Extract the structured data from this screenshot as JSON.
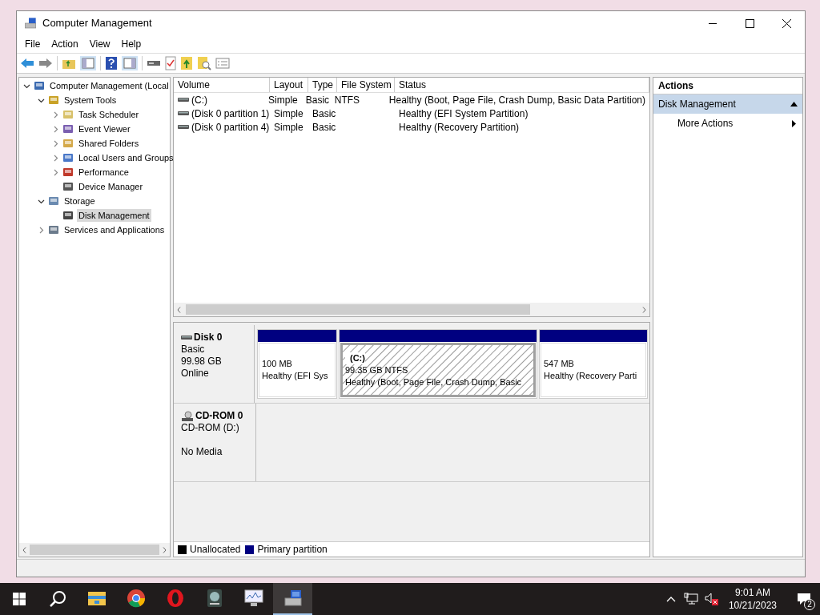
{
  "window": {
    "title": "Computer Management"
  },
  "menu": [
    "File",
    "Action",
    "View",
    "Help"
  ],
  "tree": [
    {
      "label": "Computer Management (Local",
      "expanded": true,
      "selected": false,
      "children": [
        {
          "label": "System Tools",
          "expanded": true,
          "selected": false,
          "children": [
            {
              "label": "Task Scheduler",
              "expanded": false,
              "selected": false
            },
            {
              "label": "Event Viewer",
              "expanded": false,
              "selected": false
            },
            {
              "label": "Shared Folders",
              "expanded": false,
              "selected": false
            },
            {
              "label": "Local Users and Groups",
              "expanded": false,
              "selected": false
            },
            {
              "label": "Performance",
              "expanded": false,
              "selected": false
            },
            {
              "label": "Device Manager",
              "selected": false
            }
          ]
        },
        {
          "label": "Storage",
          "expanded": true,
          "selected": false,
          "children": [
            {
              "label": "Disk Management",
              "selected": true
            }
          ]
        },
        {
          "label": "Services and Applications",
          "expanded": false,
          "selected": false
        }
      ]
    }
  ],
  "volumes": {
    "columns": [
      "Volume",
      "Layout",
      "Type",
      "File System",
      "Status"
    ],
    "rows": [
      {
        "cells": [
          "(C:)",
          "Simple",
          "Basic",
          "NTFS",
          "Healthy (Boot, Page File, Crash Dump, Basic Data Partition)"
        ]
      },
      {
        "cells": [
          "(Disk 0 partition 1)",
          "Simple",
          "Basic",
          "",
          "Healthy (EFI System Partition)"
        ]
      },
      {
        "cells": [
          "(Disk 0 partition 4)",
          "Simple",
          "Basic",
          "",
          "Healthy (Recovery Partition)"
        ]
      }
    ]
  },
  "disks": [
    {
      "kind": "disk",
      "name": "Disk 0",
      "lines": [
        "Basic",
        "99.98 GB",
        "Online"
      ],
      "partitions": [
        {
          "size": "100 MB",
          "status": "Healthy (EFI Sys",
          "selected": false
        },
        {
          "label": "(C:)",
          "size": "99.35 GB NTFS",
          "status": "Healthy (Boot, Page File, Crash Dump, Basic",
          "selected": true
        },
        {
          "size": "547 MB",
          "status": "Healthy (Recovery Parti",
          "selected": false
        }
      ]
    },
    {
      "kind": "cdrom",
      "name": "CD-ROM 0",
      "lines": [
        "CD-ROM (D:)",
        "No Media"
      ]
    }
  ],
  "legend": [
    {
      "label": "Unallocated",
      "color": "#000000"
    },
    {
      "label": "Primary partition",
      "color": "#000080"
    }
  ],
  "actions": {
    "title": "Actions",
    "section": {
      "label": "Disk Management",
      "expanded": true
    },
    "items": [
      "More Actions"
    ]
  },
  "taskbar": {
    "apps": [
      {
        "kind": "explorer",
        "active": false
      },
      {
        "kind": "chrome",
        "active": false
      },
      {
        "kind": "opera",
        "active": false
      },
      {
        "kind": "disk",
        "active": false
      },
      {
        "kind": "monitor",
        "active": false
      },
      {
        "kind": "compmgmt",
        "active": true
      }
    ],
    "time": "9:01 AM",
    "date": "10/21/2023",
    "notifications": "2"
  }
}
